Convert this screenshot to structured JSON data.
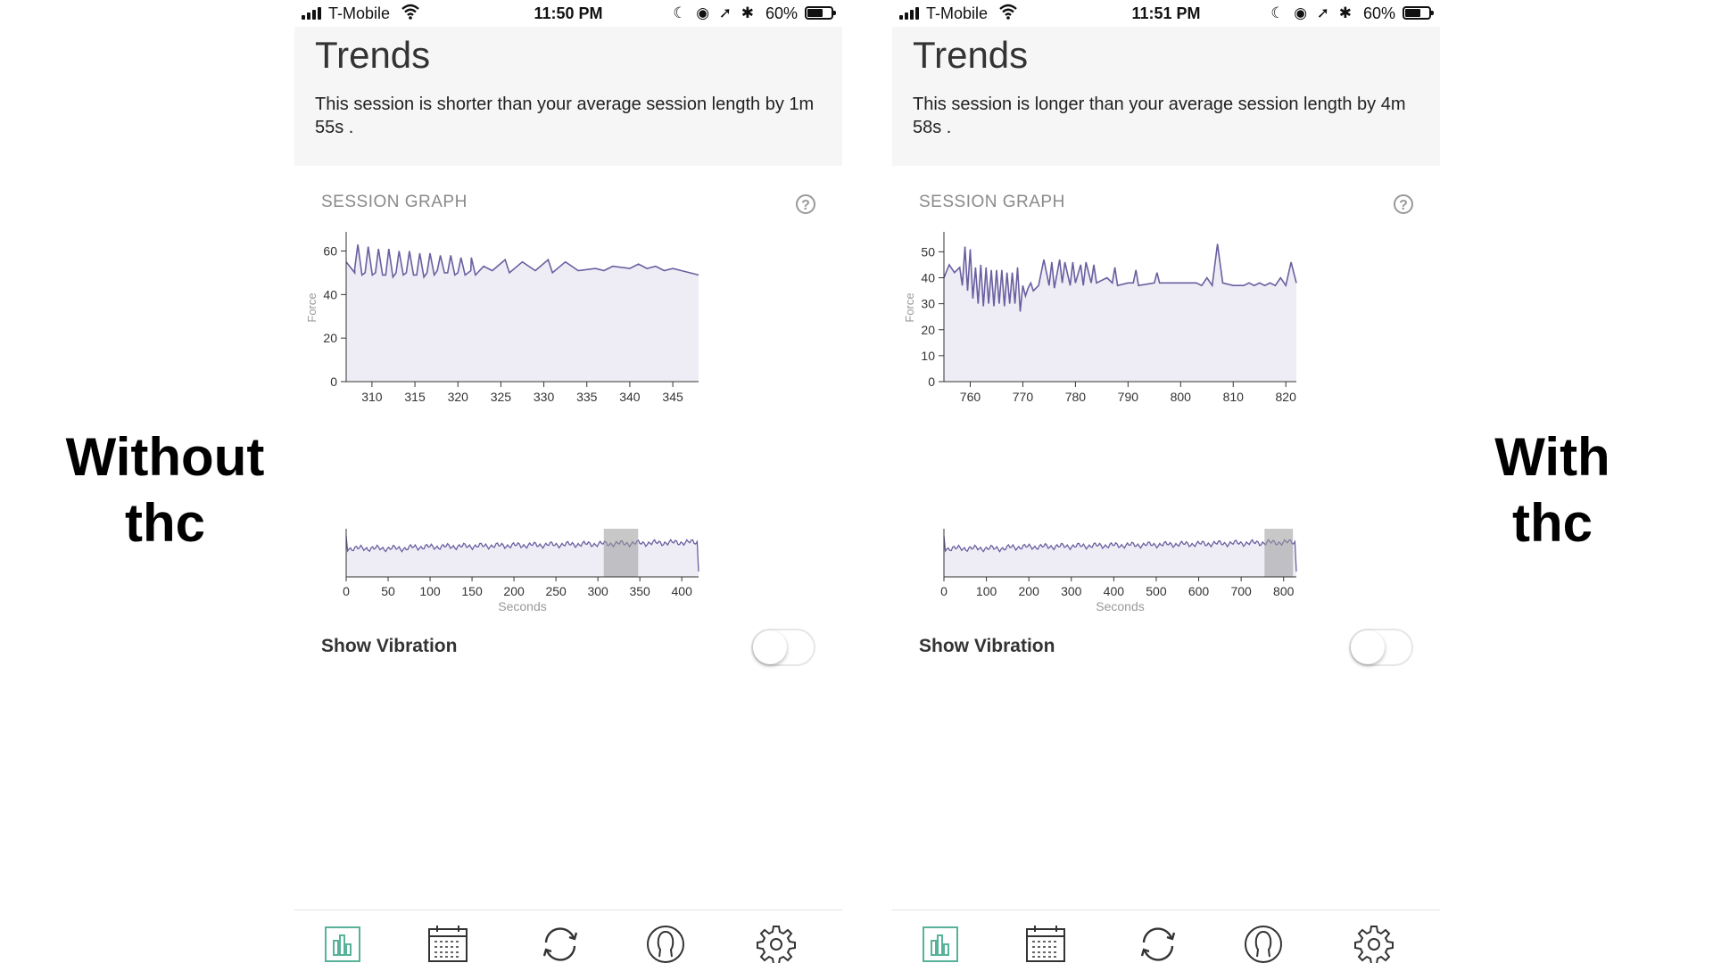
{
  "labels": {
    "left": [
      "Without",
      "thc"
    ],
    "right": [
      "With",
      "thc"
    ]
  },
  "colors": {
    "accent": "#6a5fa0",
    "fill": "#eeedf5",
    "tab_active": "#58b29a",
    "tab_inactive": "#333333"
  },
  "phones": [
    {
      "status": {
        "carrier": "T-Mobile",
        "time": "11:50 PM",
        "battery": "60%"
      },
      "title": "Trends",
      "description": "This session is shorter than your average session length by 1m 55s .",
      "section_title": "SESSION GRAPH",
      "show_vibration_label": "Show Vibration",
      "toggle_on": false,
      "chart_data": {
        "type": "area",
        "ylabel": "Force",
        "xlim": [
          307,
          348
        ],
        "ylim": [
          0,
          68
        ],
        "yticks": [
          0,
          20,
          40,
          60
        ],
        "xticks": [
          310,
          315,
          320,
          325,
          330,
          335,
          340,
          345
        ],
        "spikes": {
          "start": 308,
          "period": 1.2,
          "count": 12,
          "peaks": [
            63,
            62,
            61,
            61,
            60,
            60,
            59,
            59,
            58,
            58,
            57,
            57
          ],
          "troughs": [
            50,
            50,
            50,
            49,
            50,
            50,
            49,
            50,
            51,
            50,
            50,
            50
          ]
        },
        "x": [
          307,
          308,
          321.5,
          323,
          324,
          325.5,
          326,
          327.5,
          329,
          330.5,
          331,
          332.5,
          334,
          336,
          337,
          338,
          340,
          341,
          342,
          343,
          344,
          345,
          346,
          348
        ],
        "y": [
          55,
          52,
          51,
          53,
          51,
          56,
          50,
          55,
          51,
          56,
          50,
          55,
          51,
          52,
          51,
          53,
          52,
          54,
          52,
          53,
          51,
          52,
          51,
          49
        ]
      },
      "navigator": {
        "xlim": [
          0,
          420
        ],
        "xticks": [
          0,
          50,
          100,
          150,
          200,
          250,
          300,
          350,
          400
        ],
        "xlabel": "Seconds",
        "selection": [
          307,
          348
        ]
      }
    },
    {
      "status": {
        "carrier": "T-Mobile",
        "time": "11:51 PM",
        "battery": "60%"
      },
      "title": "Trends",
      "description": "This session is longer than your average session length by 4m 58s .",
      "section_title": "SESSION GRAPH",
      "show_vibration_label": "Show Vibration",
      "toggle_on": false,
      "chart_data": {
        "type": "area",
        "ylabel": "Force",
        "xlim": [
          755,
          822
        ],
        "ylim": [
          0,
          57
        ],
        "yticks": [
          0,
          10,
          20,
          30,
          40,
          50
        ],
        "xticks": [
          760,
          770,
          780,
          790,
          800,
          810,
          820
        ],
        "x": [
          755,
          756,
          757,
          758,
          758.5,
          759,
          759.5,
          760,
          760.5,
          761,
          761.5,
          762,
          762.5,
          763,
          763.5,
          764,
          764.5,
          765,
          765.5,
          766,
          766.5,
          767,
          767.5,
          768,
          768.5,
          769,
          769.5,
          770,
          770.5,
          771,
          771.5,
          772,
          773,
          774,
          775,
          775.5,
          776,
          777,
          777.5,
          778,
          779,
          779.5,
          780,
          781,
          781.5,
          782,
          783,
          783.5,
          784,
          786,
          787,
          787.5,
          788,
          790,
          791,
          791.5,
          792,
          795,
          795.5,
          796,
          800,
          802,
          803,
          804,
          805,
          806,
          807,
          808,
          810,
          812,
          813,
          814,
          815,
          816,
          817,
          818,
          819,
          820,
          821,
          822
        ],
        "y": [
          40,
          45,
          42,
          44,
          37,
          52,
          35,
          51,
          32,
          44,
          30,
          45,
          29,
          44,
          30,
          43,
          29,
          43,
          30,
          43,
          29,
          42,
          30,
          42,
          30,
          44,
          27,
          37,
          33,
          36,
          38,
          35,
          37,
          47,
          37,
          46,
          36,
          47,
          38,
          46,
          37,
          46,
          38,
          45,
          37,
          46,
          38,
          45,
          38,
          40,
          38,
          44,
          37,
          38,
          38,
          43,
          37,
          38,
          42,
          38,
          38,
          38,
          38,
          37,
          40,
          37,
          53,
          38,
          37,
          37,
          38,
          37,
          38,
          37,
          38,
          37,
          40,
          37,
          46,
          38,
          38
        ]
      },
      "navigator": {
        "xlim": [
          0,
          830
        ],
        "xticks": [
          0,
          100,
          200,
          300,
          400,
          500,
          600,
          700,
          800
        ],
        "xlabel": "Seconds",
        "selection": [
          755,
          822
        ]
      }
    }
  ]
}
